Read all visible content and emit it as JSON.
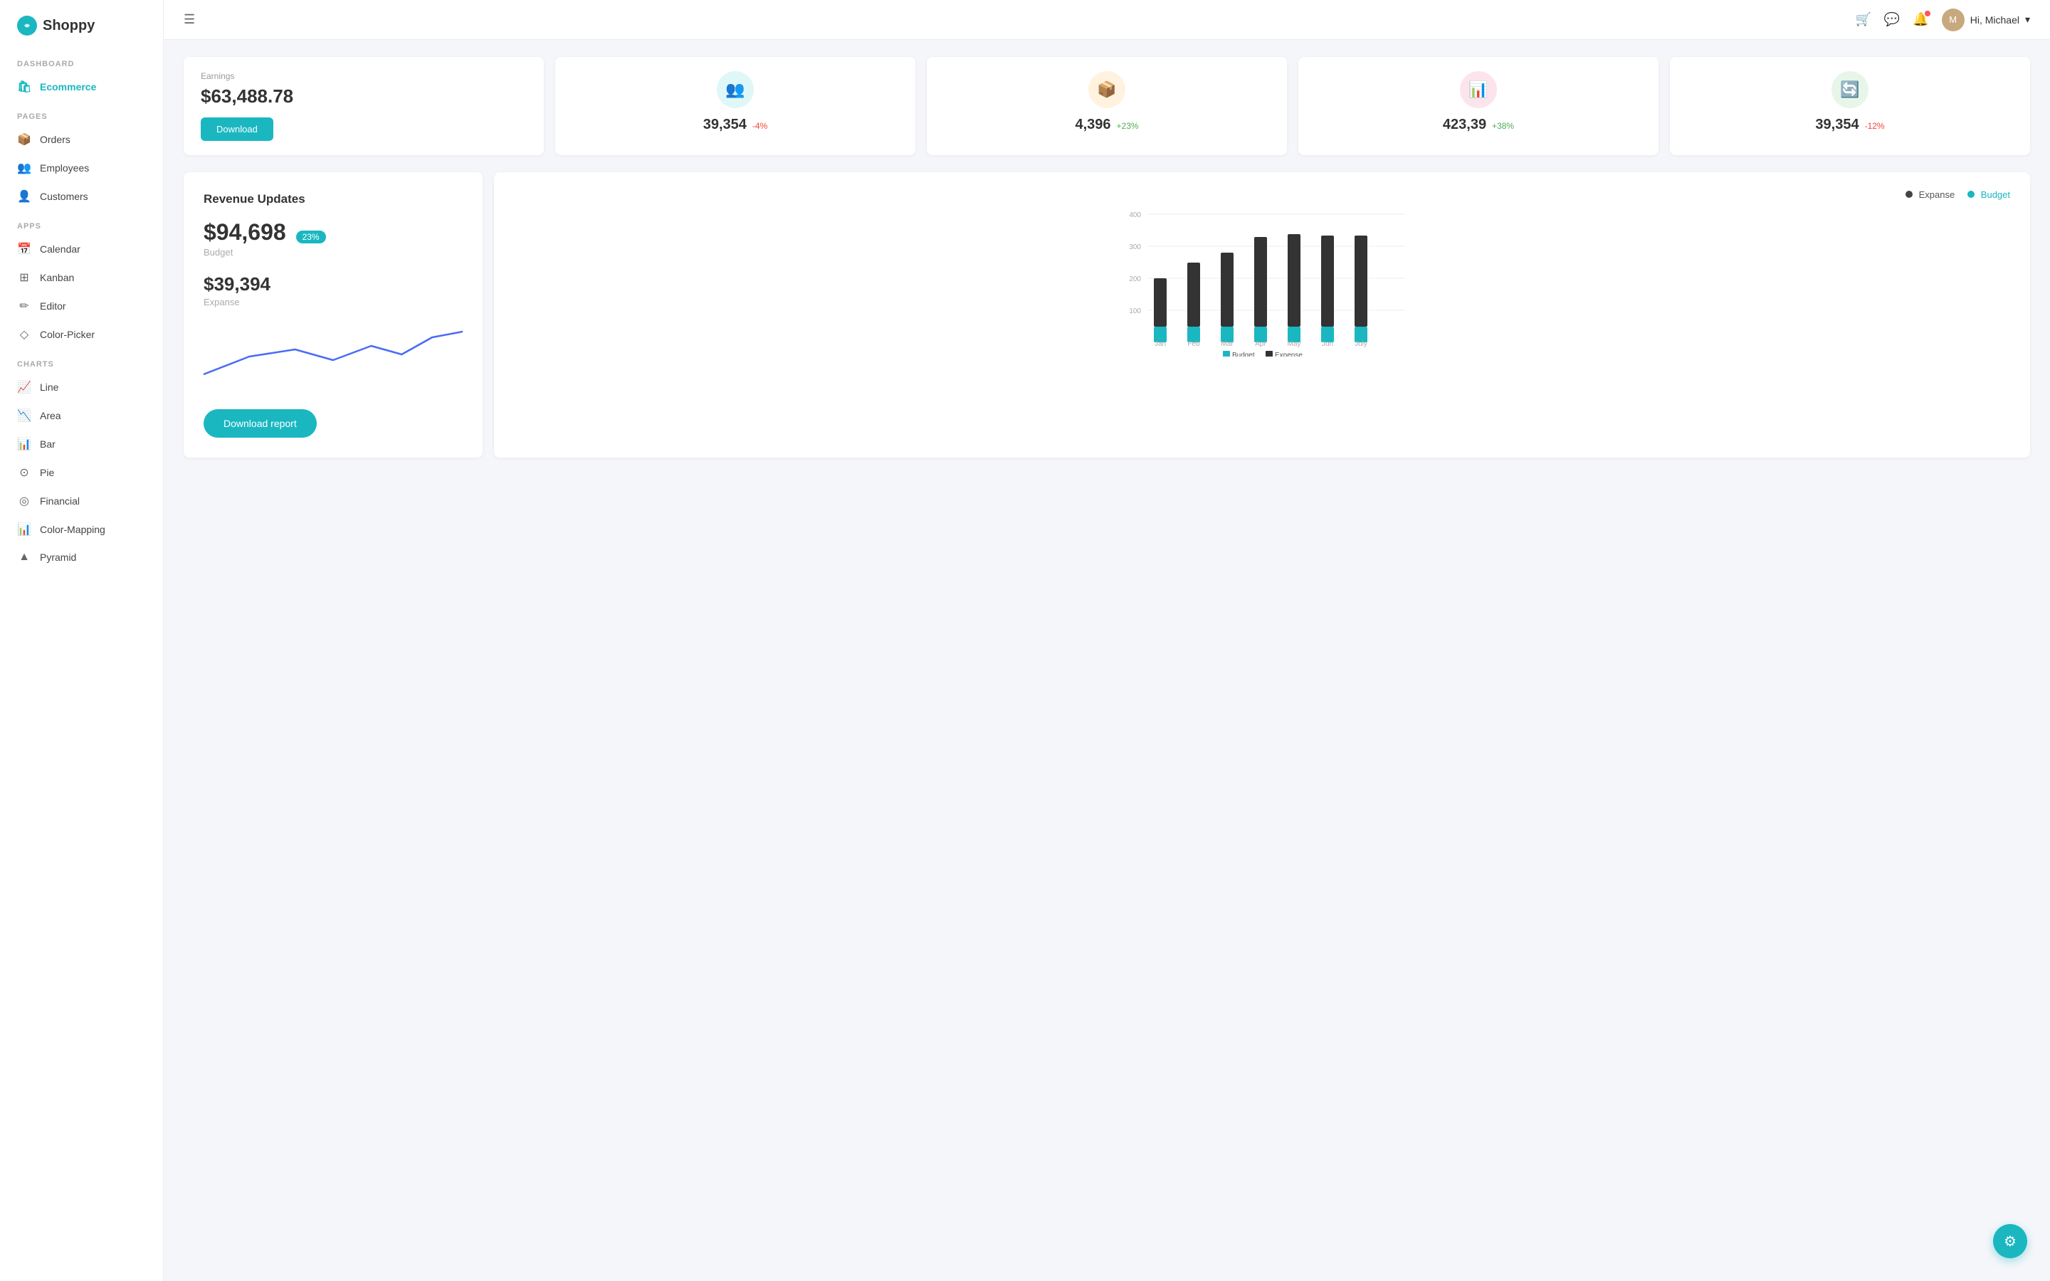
{
  "app": {
    "name": "Shoppy",
    "logo_icon": "S"
  },
  "topbar": {
    "menu_icon": "☰",
    "cart_icon": "🛒",
    "chat_icon": "💬",
    "bell_icon": "🔔",
    "user_greeting": "Hi, Michael",
    "user_avatar": "M"
  },
  "sidebar": {
    "sections": [
      {
        "label": "DASHBOARD",
        "items": [
          {
            "id": "ecommerce",
            "label": "Ecommerce",
            "icon": "🛍",
            "active": true
          }
        ]
      },
      {
        "label": "PAGES",
        "items": [
          {
            "id": "orders",
            "label": "Orders",
            "icon": "📦"
          },
          {
            "id": "employees",
            "label": "Employees",
            "icon": "👥"
          },
          {
            "id": "customers",
            "label": "Customers",
            "icon": "👤"
          }
        ]
      },
      {
        "label": "APPS",
        "items": [
          {
            "id": "calendar",
            "label": "Calendar",
            "icon": "📅"
          },
          {
            "id": "kanban",
            "label": "Kanban",
            "icon": "⊞"
          },
          {
            "id": "editor",
            "label": "Editor",
            "icon": "✏"
          },
          {
            "id": "color-picker",
            "label": "Color-Picker",
            "icon": "◇"
          }
        ]
      },
      {
        "label": "CHARTS",
        "items": [
          {
            "id": "line",
            "label": "Line",
            "icon": "📈"
          },
          {
            "id": "area",
            "label": "Area",
            "icon": "📉"
          },
          {
            "id": "bar",
            "label": "Bar",
            "icon": "📊"
          },
          {
            "id": "pie",
            "label": "Pie",
            "icon": "⊙"
          },
          {
            "id": "financial",
            "label": "Financial",
            "icon": "◎"
          },
          {
            "id": "color-mapping",
            "label": "Color-Mapping",
            "icon": "📊"
          },
          {
            "id": "pyramid",
            "label": "Pyramid",
            "icon": "▲"
          }
        ]
      }
    ]
  },
  "stats": [
    {
      "id": "earnings",
      "type": "earnings",
      "label": "Earnings",
      "value": "$63,488.78",
      "download_btn": "Download"
    },
    {
      "id": "customers-stat",
      "type": "icon",
      "icon": "👥",
      "icon_color": "teal",
      "number": "39,354",
      "change": "-4%",
      "change_type": "neg"
    },
    {
      "id": "products-stat",
      "type": "icon",
      "icon": "📦",
      "icon_color": "orange",
      "number": "4,396",
      "change": "+23%",
      "change_type": "pos"
    },
    {
      "id": "sales-stat",
      "type": "icon",
      "icon": "📊",
      "icon_color": "pink",
      "number": "423,39",
      "change": "+38%",
      "change_type": "pos"
    },
    {
      "id": "refunds-stat",
      "type": "icon",
      "icon": "🔄",
      "icon_color": "green",
      "number": "39,354",
      "change": "-12%",
      "change_type": "neg"
    }
  ],
  "revenue": {
    "title": "Revenue Updates",
    "legend_expanse": "Expanse",
    "legend_budget": "Budget",
    "budget_amount": "$94,698",
    "budget_badge": "23%",
    "budget_label": "Budget",
    "expanse_amount": "$39,394",
    "expanse_label": "Expanse",
    "download_report_btn": "Download report",
    "chart_months": [
      "Jan",
      "Feb",
      "Mar",
      "Apr",
      "May",
      "Jun",
      "July"
    ],
    "chart_legend_budget": "Budget",
    "chart_legend_expense": "Expense",
    "bar_data": [
      {
        "month": "Jan",
        "budget": 135,
        "expense": 90
      },
      {
        "month": "Feb",
        "budget": 170,
        "expense": 95
      },
      {
        "month": "Mar",
        "budget": 200,
        "expense": 100
      },
      {
        "month": "Apr",
        "budget": 250,
        "expense": 100
      },
      {
        "month": "May",
        "budget": 260,
        "expense": 95
      },
      {
        "month": "Jun",
        "budget": 255,
        "expense": 95
      },
      {
        "month": "July",
        "budget": 255,
        "expense": 95
      }
    ],
    "y_axis": [
      "100",
      "200",
      "300",
      "400"
    ]
  },
  "fab": {
    "icon": "⚙",
    "label": "settings"
  }
}
